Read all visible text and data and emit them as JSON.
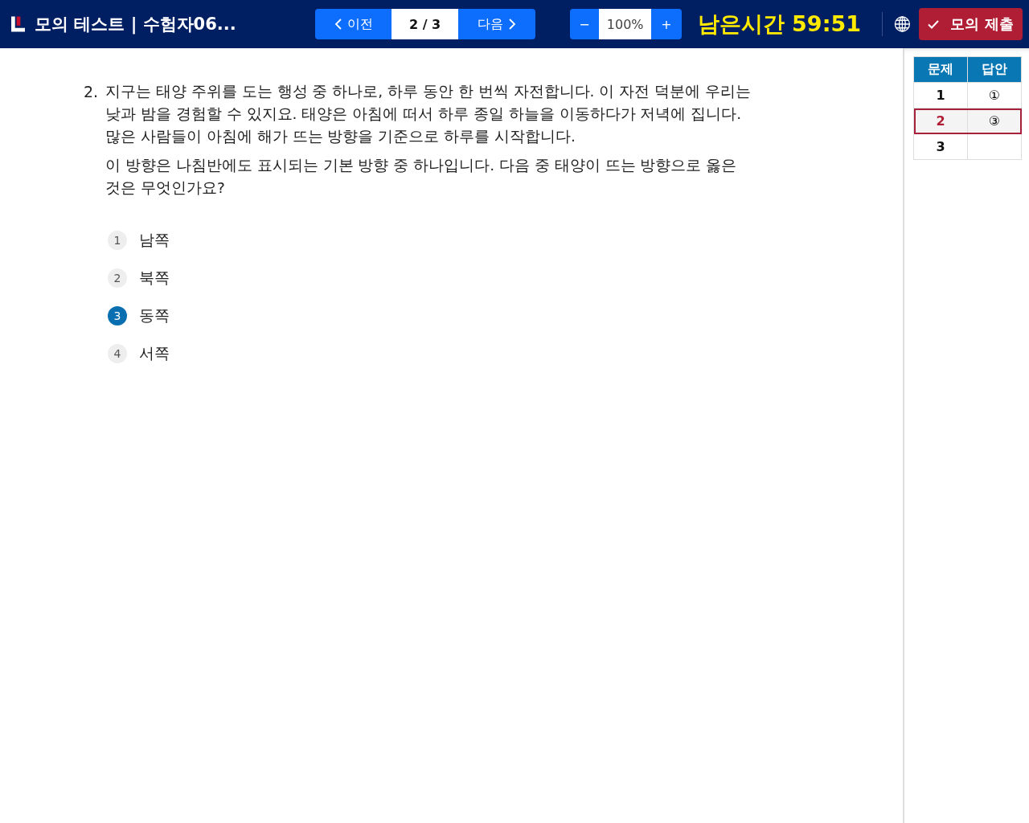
{
  "header": {
    "title": "모의 테스트 | 수험자06...",
    "prev_label": "이전",
    "page": "2 / 3",
    "next_label": "다음",
    "zoom_minus": "−",
    "zoom": "100%",
    "zoom_plus": "+",
    "timer_label": "남은시간",
    "timer": "59:51",
    "submit_label": "모의 제출"
  },
  "question": {
    "number": "2.",
    "paragraphs": [
      "지구는 태양 주위를 도는 행성 중 하나로, 하루 동안 한 번씩 자전합니다. 이 자전 덕분에 우리는 낮과 밤을 경험할 수 있지요. 태양은 아침에 떠서 하루 종일 하늘을 이동하다가 저녁에 집니다. 많은 사람들이 아침에 해가 뜨는 방향을 기준으로 하루를 시작합니다.",
      "이 방향은 나침반에도 표시되는 기본 방향 중 하나입니다. 다음 중 태양이 뜨는 방향으로 옳은 것은 무엇인가요?"
    ],
    "options": [
      {
        "number": "1",
        "label": "남쪽",
        "selected": false
      },
      {
        "number": "2",
        "label": "북쪽",
        "selected": false
      },
      {
        "number": "3",
        "label": "동쪽",
        "selected": true
      },
      {
        "number": "4",
        "label": "서쪽",
        "selected": false
      }
    ]
  },
  "answer_table": {
    "columns": [
      "문제",
      "답안"
    ],
    "rows": [
      {
        "question": "1",
        "answer": "①",
        "selected": false
      },
      {
        "question": "2",
        "answer": "③",
        "selected": true
      },
      {
        "question": "3",
        "selected": false
      }
    ]
  }
}
